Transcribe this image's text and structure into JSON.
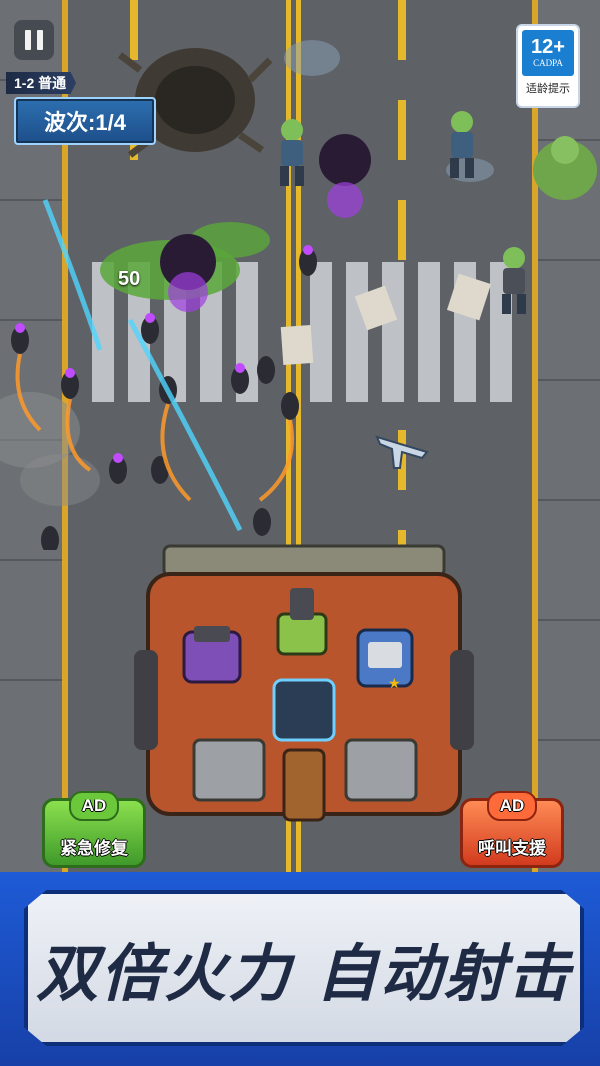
{
  "hud": {
    "level": "1-2 普通",
    "wave": "波次:1/4",
    "floating_score": "50"
  },
  "age_rating": {
    "value": "12+",
    "org": "CADPA",
    "tip": "适龄提示"
  },
  "buttons": {
    "repair": {
      "ad": "AD",
      "label": "紧急修复"
    },
    "call_support": {
      "ad": "AD",
      "label": "呼叫支援"
    }
  },
  "banner": {
    "text": "双倍火力 自动射击"
  },
  "colors": {
    "road": "#5f6367",
    "lane_line": "#e5b92b",
    "banner_blue": "#1e5bd6",
    "repair_green": "#6cc83b",
    "call_red": "#ff6a3a"
  },
  "icons": [
    "pause-icon",
    "zombie-icon",
    "airplane-icon",
    "turret-icon",
    "missile-icon"
  ]
}
